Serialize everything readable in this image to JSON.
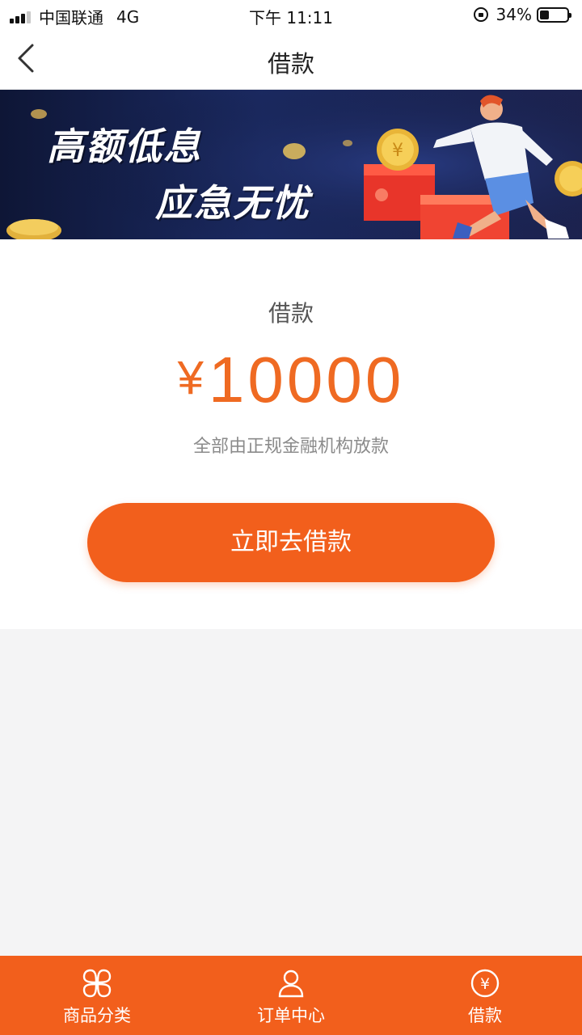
{
  "status_bar": {
    "carrier": "中国联通",
    "network": "4G",
    "time": "下午 11:11",
    "battery": "34%",
    "battery_level": 0.34,
    "signal_bars": 3
  },
  "nav": {
    "title": "借款"
  },
  "banner": {
    "line1": "高额低息",
    "line2": "应急无忧"
  },
  "loan": {
    "label": "借款",
    "currency": "¥",
    "amount": "10000",
    "note": "全部由正规金融机构放款",
    "button_label": "立即去借款"
  },
  "tab_bar": {
    "items": [
      {
        "label": "商品分类",
        "icon": "categories-icon"
      },
      {
        "label": "订单中心",
        "icon": "user-icon"
      },
      {
        "label": "借款",
        "icon": "yen-coin-icon"
      }
    ]
  },
  "colors": {
    "accent": "#f25f1c",
    "amount": "#ef6a22",
    "background": "#f4f4f5"
  }
}
